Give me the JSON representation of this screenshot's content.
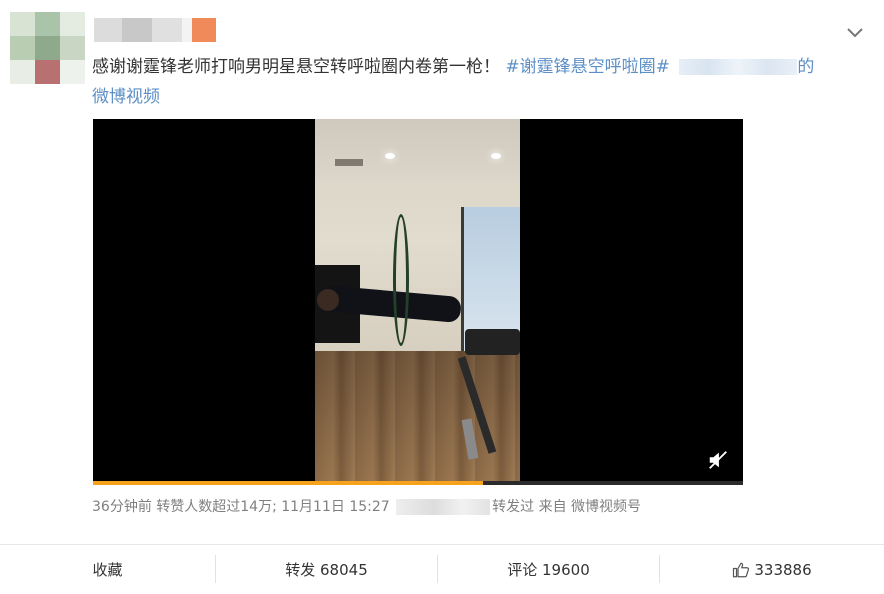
{
  "post": {
    "text_main": "感谢谢霆锋老师打响男明星悬空转呼啦圈内卷第一枪！",
    "hashtag": "#谢霆锋悬空呼啦圈#",
    "source_suffix": "的",
    "source_line2": "微博视频"
  },
  "video": {
    "progress": 0.6,
    "mute_icon": "mute-icon"
  },
  "meta": {
    "time_info": "36分钟前 转赞人数超过14万; 11月11日 15:27",
    "forwarded": "转发过",
    "from_label": "来自",
    "from_source": "微博视频号"
  },
  "actions": {
    "favorite": "收藏",
    "repost": "转发 68045",
    "comment": "评论 19600",
    "like": "333886"
  },
  "colors": {
    "link": "#5d8fc6",
    "progress": "#f7a21b"
  }
}
